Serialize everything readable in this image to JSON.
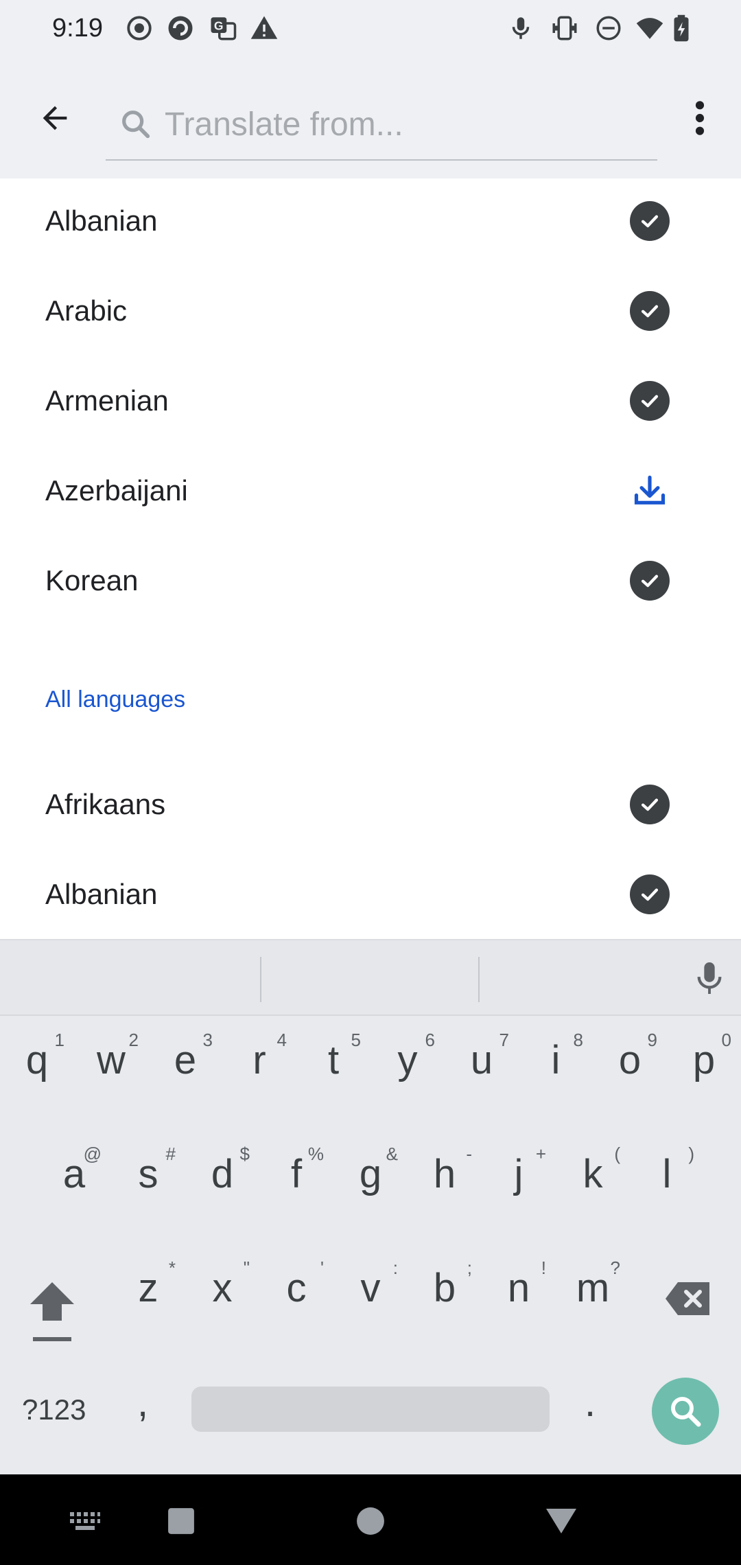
{
  "status_bar": {
    "time": "9:19",
    "left_icons": [
      "record-icon",
      "photos-icon",
      "translate-icon",
      "warning-icon"
    ],
    "right_icons": [
      "mic-icon",
      "vibrate-icon",
      "dnd-icon",
      "wifi-icon",
      "battery-charging-icon"
    ]
  },
  "app_bar": {
    "search_placeholder": "Translate from..."
  },
  "downloaded_languages": [
    {
      "label": "Albanian",
      "status": "downloaded"
    },
    {
      "label": "Arabic",
      "status": "downloaded"
    },
    {
      "label": "Armenian",
      "status": "downloaded"
    },
    {
      "label": "Azerbaijani",
      "status": "download-available"
    },
    {
      "label": "Korean",
      "status": "downloaded"
    }
  ],
  "all_languages": {
    "header": "All languages",
    "items": [
      {
        "label": "Afrikaans",
        "status": "downloaded"
      },
      {
        "label": "Albanian",
        "status": "downloaded"
      }
    ]
  },
  "keyboard": {
    "row1": [
      {
        "ch": "q",
        "sup": "1"
      },
      {
        "ch": "w",
        "sup": "2"
      },
      {
        "ch": "e",
        "sup": "3"
      },
      {
        "ch": "r",
        "sup": "4"
      },
      {
        "ch": "t",
        "sup": "5"
      },
      {
        "ch": "y",
        "sup": "6"
      },
      {
        "ch": "u",
        "sup": "7"
      },
      {
        "ch": "i",
        "sup": "8"
      },
      {
        "ch": "o",
        "sup": "9"
      },
      {
        "ch": "p",
        "sup": "0"
      }
    ],
    "row2": [
      {
        "ch": "a",
        "sup": "@"
      },
      {
        "ch": "s",
        "sup": "#"
      },
      {
        "ch": "d",
        "sup": "$"
      },
      {
        "ch": "f",
        "sup": "%"
      },
      {
        "ch": "g",
        "sup": "&"
      },
      {
        "ch": "h",
        "sup": "-"
      },
      {
        "ch": "j",
        "sup": "+"
      },
      {
        "ch": "k",
        "sup": "("
      },
      {
        "ch": "l",
        "sup": ")"
      }
    ],
    "row3": [
      {
        "ch": "z",
        "sup": "*"
      },
      {
        "ch": "x",
        "sup": "\""
      },
      {
        "ch": "c",
        "sup": "'"
      },
      {
        "ch": "v",
        "sup": ":"
      },
      {
        "ch": "b",
        "sup": ";"
      },
      {
        "ch": "n",
        "sup": "!"
      },
      {
        "ch": "m",
        "sup": "?"
      }
    ],
    "symbols_label": "?123",
    "comma": ",",
    "period": "."
  },
  "colors": {
    "accent": "#1a56d0",
    "check_bg": "#3c4043",
    "enter_key": "#6fbdad"
  }
}
